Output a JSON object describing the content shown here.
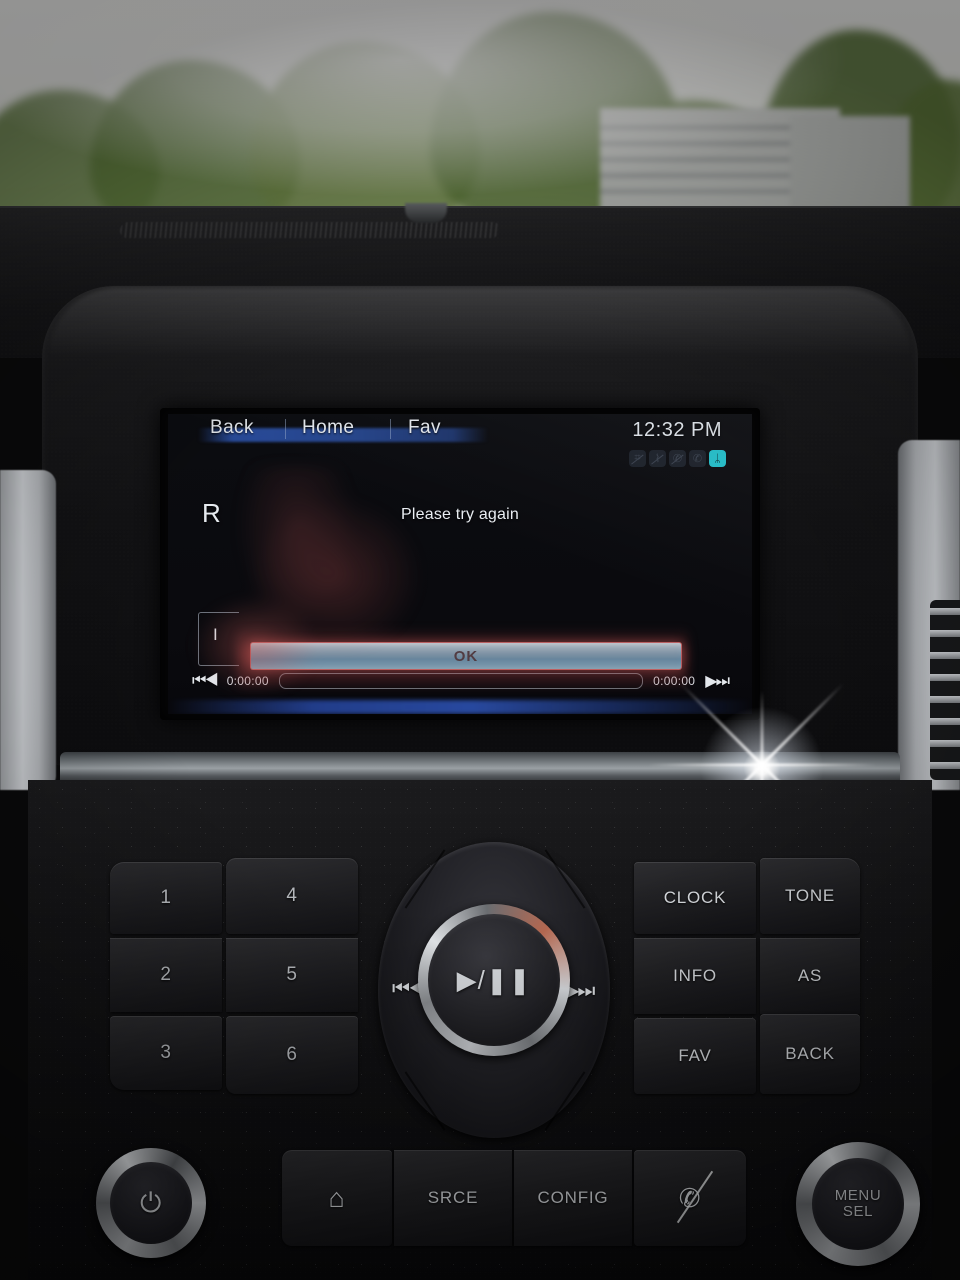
{
  "scene": {
    "description": "Chevrolet MyLink car infotainment head unit showing an error dialog",
    "outside": {
      "sky": "overexposed bright sky",
      "foliage": "blurred green treeline",
      "building": "pale apartment block"
    }
  },
  "screen": {
    "tabs": [
      {
        "label": "Back",
        "name": "tab-back"
      },
      {
        "label": "Home",
        "name": "tab-home"
      },
      {
        "label": "Fav",
        "name": "tab-fav"
      }
    ],
    "clock": "12:32 PM",
    "status_icons": [
      {
        "name": "network-disabled-icon",
        "glyph": "⌗",
        "active": false
      },
      {
        "name": "signal-disabled-icon",
        "glyph": "⌇",
        "active": false
      },
      {
        "name": "call-disabled-icon",
        "glyph": "✆",
        "active": false
      },
      {
        "name": "phone-icon",
        "glyph": "✆",
        "active": false
      },
      {
        "name": "bluetooth-icon",
        "glyph": "ᛦ",
        "active": true
      }
    ],
    "left_label": "R",
    "list_item_label": "I",
    "dialog": {
      "message": "Please try again",
      "ok_label": "OK"
    },
    "transport": {
      "prev_glyph": "⏮◀",
      "next_glyph": "▶⏭",
      "elapsed": "0:00:00",
      "remaining": "0:00:00",
      "progress_percent": 0
    },
    "colors": {
      "accent_cyan": "#36a6cb",
      "bluetooth_teal": "#22b9c4",
      "tabbar_blue": "#2a4ea0",
      "glare_red": "#c45a5a"
    }
  },
  "fascia": {
    "presets": [
      {
        "label": "1"
      },
      {
        "label": "2"
      },
      {
        "label": "3"
      },
      {
        "label": "4"
      },
      {
        "label": "5"
      },
      {
        "label": "6"
      }
    ],
    "right_buttons": [
      {
        "label": "CLOCK"
      },
      {
        "label": "TONE"
      },
      {
        "label": "INFO"
      },
      {
        "label": "AS"
      },
      {
        "label": "FAV"
      },
      {
        "label": "BACK"
      }
    ],
    "media_ring": {
      "prev_glyph": "⏮◀",
      "next_glyph": "▶⏭",
      "play_pause_glyph": "▶/❚❚"
    },
    "bottom_row": [
      {
        "label": "",
        "icon": "home-icon",
        "glyph": "⌂"
      },
      {
        "label": "SRCE",
        "icon": "",
        "glyph": ""
      },
      {
        "label": "CONFIG",
        "icon": "",
        "glyph": ""
      },
      {
        "label": "",
        "icon": "phone-mute-icon",
        "glyph": "✆"
      }
    ],
    "power_knob": {
      "icon": "power-icon",
      "glyph": "⏻"
    },
    "menu_knob": {
      "line1": "MENU",
      "line2": "SEL"
    }
  }
}
